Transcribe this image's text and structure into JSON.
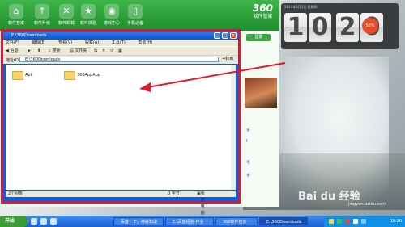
{
  "app360": {
    "toolbar": [
      {
        "label": "软件管家",
        "icon": "home-icon"
      },
      {
        "label": "软件升级",
        "icon": "upgrade-icon"
      },
      {
        "label": "软件卸载",
        "icon": "uninstall-icon"
      },
      {
        "label": "软件体验",
        "icon": "experience-icon"
      },
      {
        "label": "游戏中心",
        "icon": "gamepad-icon"
      },
      {
        "label": "手机必备",
        "icon": "phone-icon"
      }
    ],
    "brand_top": "360",
    "brand_sub": "软件管家",
    "side_button": "登录",
    "side_links": [
      "手",
      "t",
      "号",
      "手"
    ]
  },
  "explorer": {
    "title": "E:\\360Downloads",
    "menu": [
      "文件(F)",
      "编辑(E)",
      "查看(V)",
      "收藏(A)",
      "工具(T)",
      "帮助(H)"
    ],
    "tools": {
      "back": "后退",
      "search": "搜索",
      "folders": "文件夹"
    },
    "address_label": "地址(D)",
    "address_value": "E:\\360Downloads",
    "go": "转到",
    "folders": [
      "Apk",
      "360AppApp"
    ],
    "status_left": "2个对象",
    "status_mid": "0 字节",
    "status_right": "我的电脑"
  },
  "clock": {
    "header": "2014年5月1日 星期四",
    "digits": [
      "1",
      "0",
      "2",
      "0"
    ],
    "badge": "56%"
  },
  "watermark": {
    "main": "Bai du 经验",
    "sub": "jingyan.baidu.com"
  },
  "taskbar": {
    "start": "开始",
    "tasks": [
      "百度一下，你就知道",
      "E:\\百度经验-作业",
      "360软件管家",
      "E:\\360Downloads"
    ],
    "time": "10:20"
  },
  "colors": {
    "accent": "#1f8f2c",
    "highlight": "#d21b3a",
    "arrow": "#e01a2c"
  }
}
